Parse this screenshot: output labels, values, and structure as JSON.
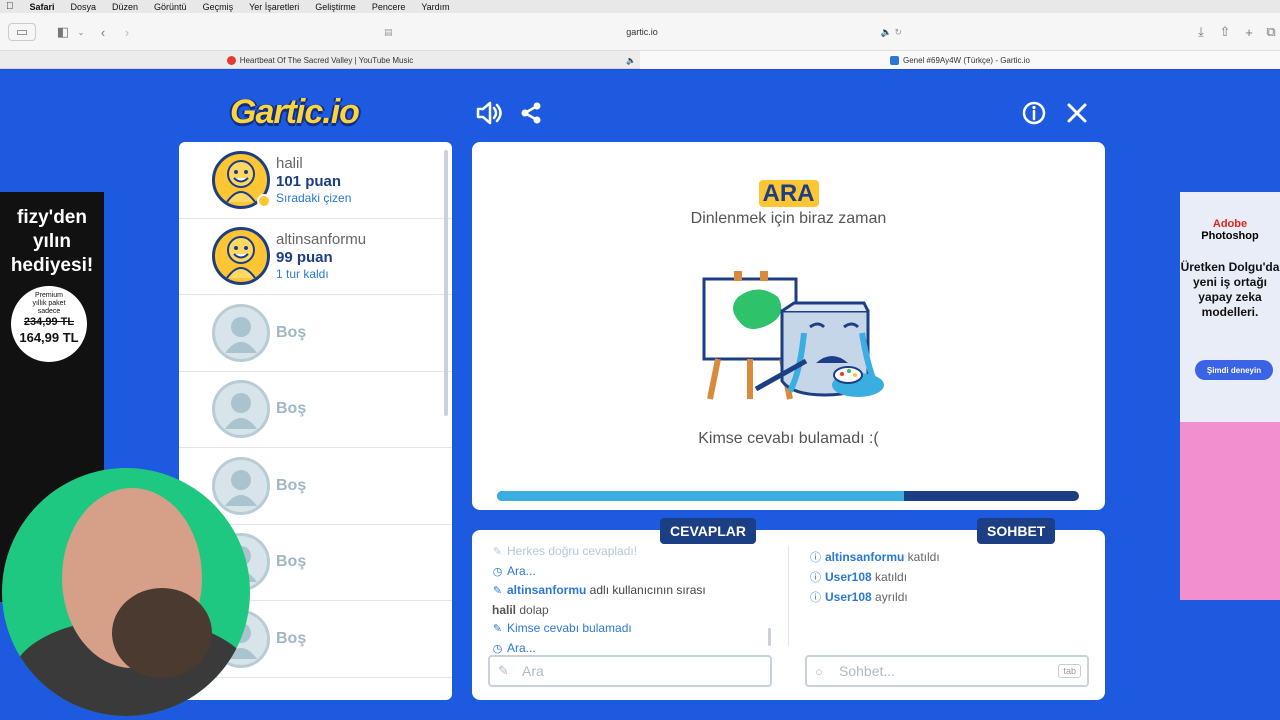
{
  "menubar": {
    "apple": "",
    "app": "Safari",
    "items": [
      "Dosya",
      "Düzen",
      "Görüntü",
      "Geçmiş",
      "Yer İşaretleri",
      "Geliştirme",
      "Pencere",
      "Yardım"
    ]
  },
  "browser": {
    "url": "gartic.io",
    "tabs": [
      {
        "title": "Heartbeat Of The Sacred Valley | YouTube Music",
        "favicon_color": "#e53935"
      },
      {
        "title": "Genel #69Ay4W (Türkçe) - Gartic.io",
        "favicon_color": "#2a78d6"
      }
    ]
  },
  "game": {
    "logo": "Gartic.io",
    "players": [
      {
        "name": "halil",
        "score": "101 puan",
        "status": "Sıradaki çizen"
      },
      {
        "name": "altinsanformu",
        "score": "99 puan",
        "status": "1 tur kaldı"
      },
      {
        "name": "Boş"
      },
      {
        "name": "Boş"
      },
      {
        "name": "Boş"
      },
      {
        "name": "Boş"
      },
      {
        "name": "Boş"
      }
    ],
    "stage": {
      "title": "ARA",
      "subtitle": "Dinlenmek için biraz zaman",
      "message": "Kimse cevabı bulamadı :(",
      "progress": 0.7
    },
    "answers": {
      "label": "CEVAPLAR",
      "lines": [
        {
          "icon": "pencil-icon",
          "text": "Herkes doğru cevapladı!",
          "style": "faded"
        },
        {
          "icon": "clock-icon",
          "text": "Ara...",
          "style": "blue"
        },
        {
          "icon": "pencil-icon",
          "bold": "altinsanformu",
          "text": " adlı kullanıcının sırası",
          "style": "mixed"
        },
        {
          "icon": "",
          "bold": "halil",
          "text": " dolap",
          "style": "plain"
        },
        {
          "icon": "pencil-icon",
          "text": "Kimse cevabı bulamadı",
          "style": "blue"
        },
        {
          "icon": "clock-icon",
          "text": "Ara...",
          "style": "blue"
        }
      ],
      "input_placeholder": "Ara"
    },
    "chat": {
      "label": "SOHBET",
      "lines": [
        {
          "user": "altinsanformu",
          "action": " katıldı"
        },
        {
          "user": "User108",
          "action": " katıldı"
        },
        {
          "user": "User108",
          "action": " ayrıldı"
        }
      ],
      "input_placeholder": "Sohbet...",
      "tab_hint": "tab"
    }
  },
  "ads": {
    "left": {
      "headline": "fizy'den yılın hediyesi!",
      "line1": "Premium",
      "line2": "yıllık paket",
      "line3": "sadece",
      "old_price": "234,99 TL",
      "new_price": "164,99 TL"
    },
    "right": {
      "brand1": "Adobe",
      "brand2": "Photoshop",
      "copy": "Üretken Dolgu'da yeni iş ortağı yapay zeka modelleri.",
      "cta": "Şimdi deneyin"
    }
  }
}
